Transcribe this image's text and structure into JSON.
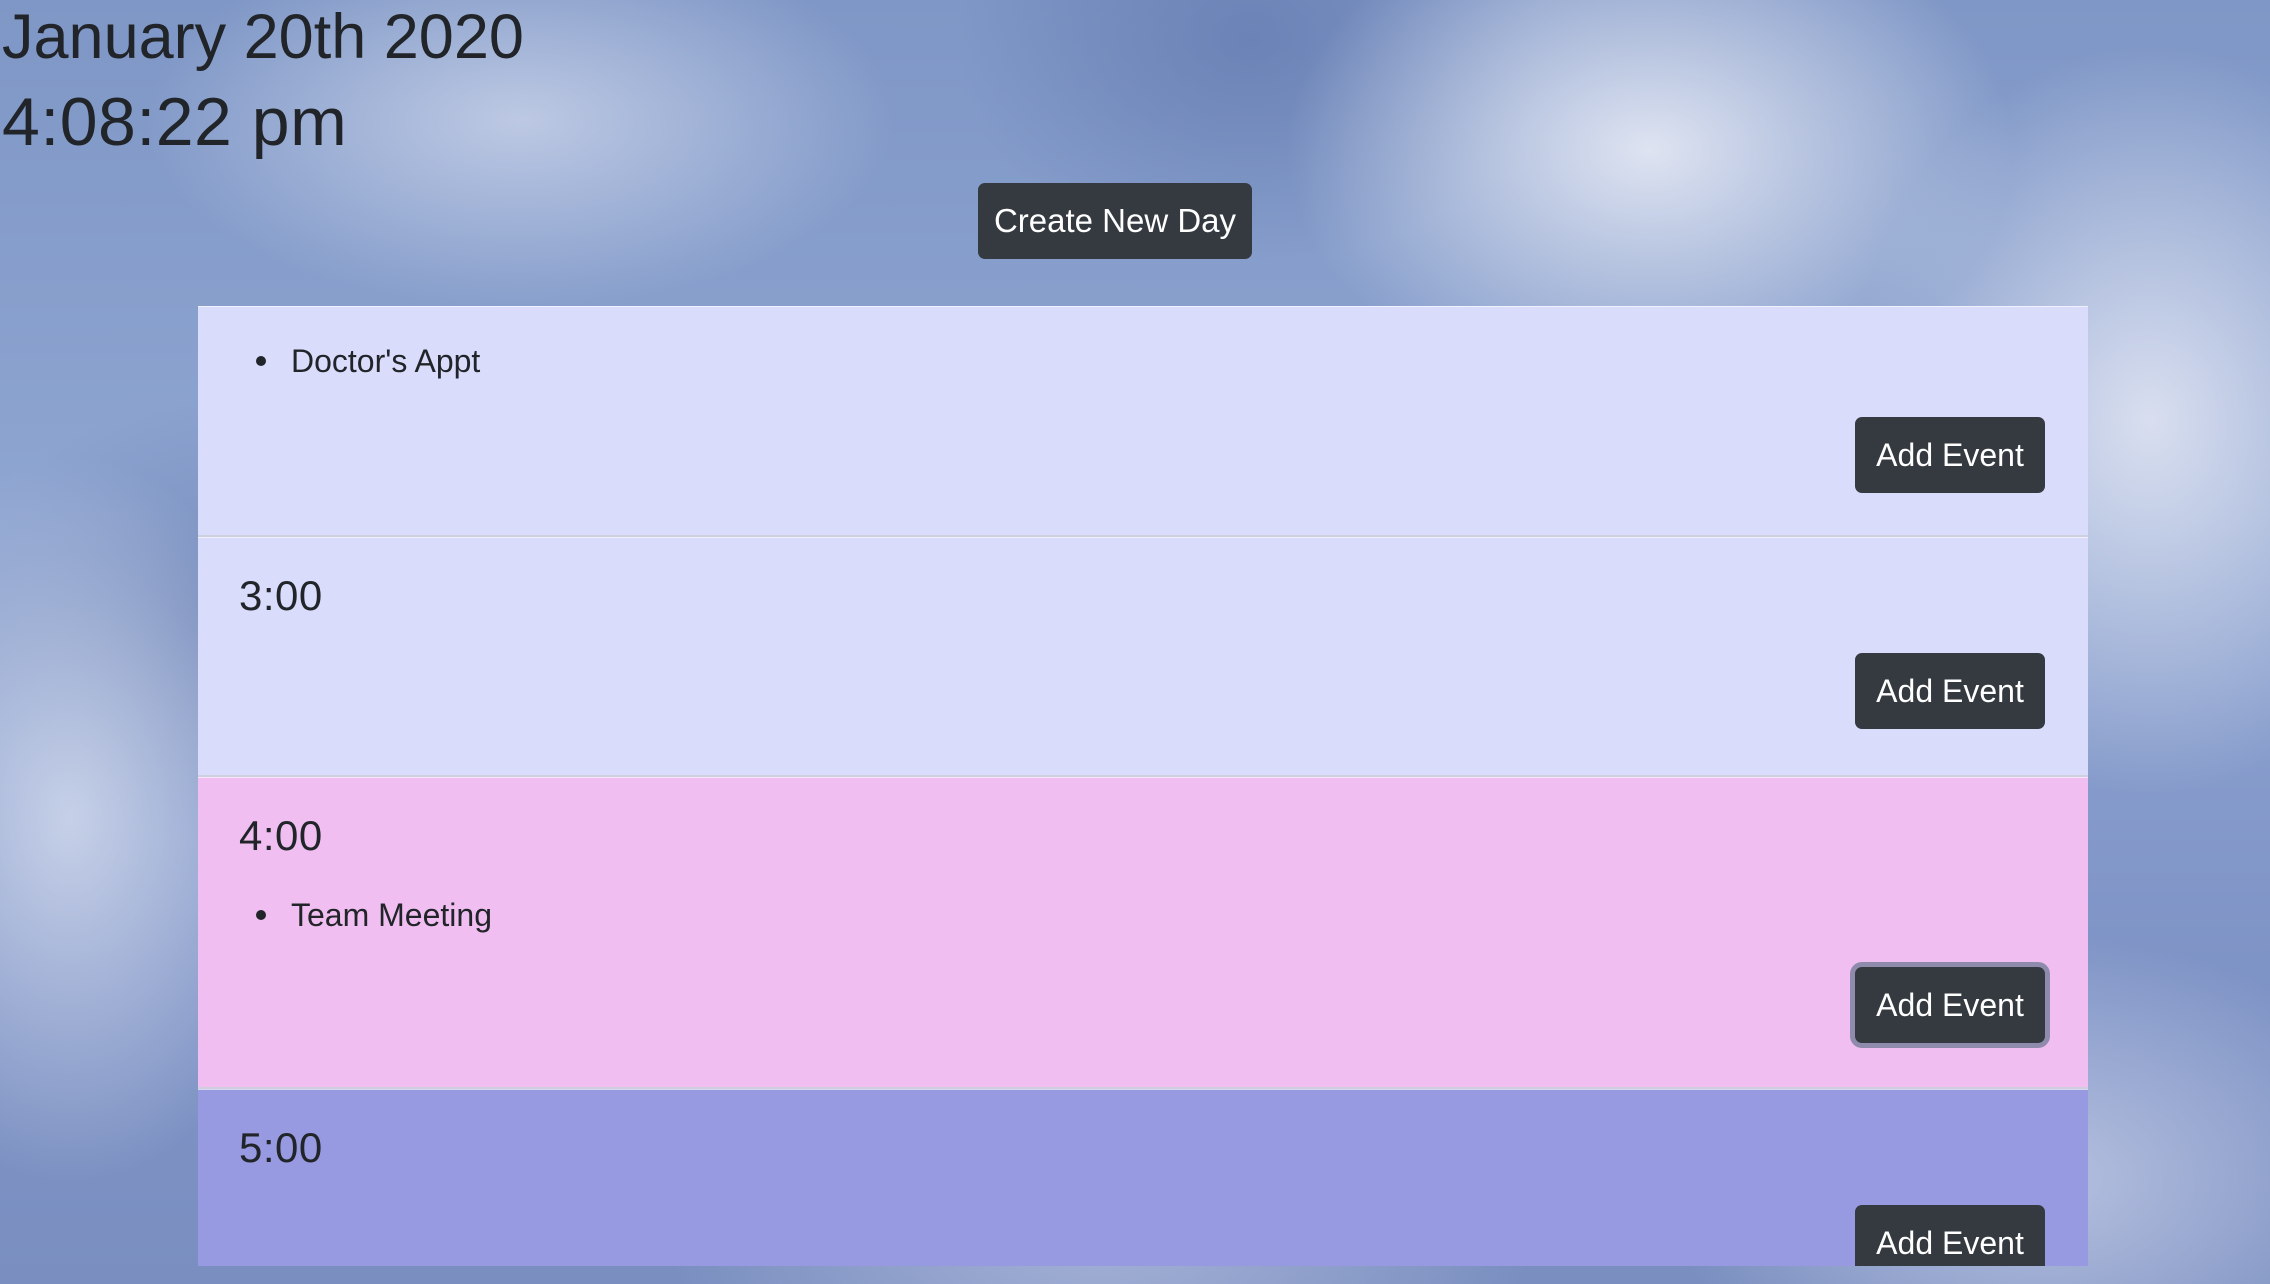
{
  "header": {
    "date": "January 20th 2020",
    "time": "4:08:22 pm"
  },
  "toolbar": {
    "create_new_day_label": "Create New Day"
  },
  "hour_blocks": [
    {
      "hour_label": "",
      "events": [
        "Doctor's Appt"
      ],
      "add_event_label": "Add Event",
      "color": "#dadcfc"
    },
    {
      "hour_label": "3:00",
      "events": [],
      "add_event_label": "Add Event",
      "color": "#dadcfc"
    },
    {
      "hour_label": "4:00",
      "events": [
        "Team Meeting"
      ],
      "add_event_label": "Add Event",
      "color": "#f0bef0"
    },
    {
      "hour_label": "5:00",
      "events": [],
      "add_event_label": "Add Event",
      "color": "#979ae0"
    }
  ],
  "colors": {
    "button_background": "#343a40",
    "button_text": "#ffffff",
    "text": "#212529",
    "past_hour": "#dadcfc",
    "present_hour": "#f0bef0",
    "future_hour": "#979ae0"
  }
}
